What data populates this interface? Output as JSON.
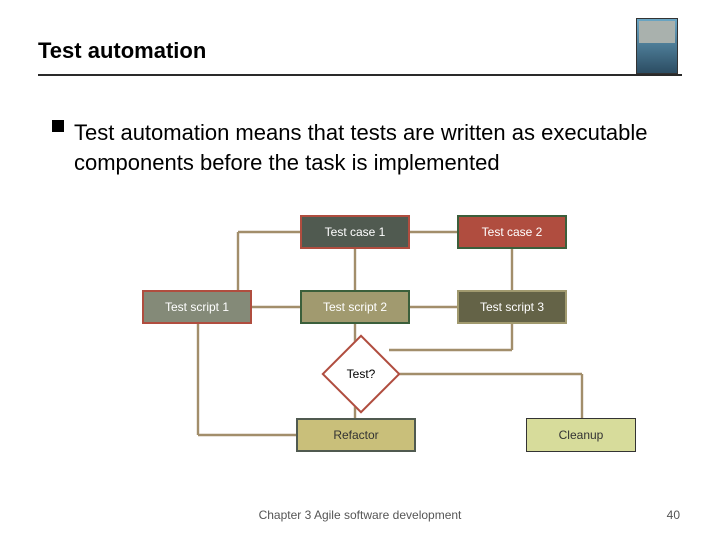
{
  "title": "Test automation",
  "bullet": "Test automation means that tests are written as executable components before the task is implemented",
  "boxes": {
    "tc1": "Test case 1",
    "tc2": "Test case 2",
    "ts1": "Test script 1",
    "ts2": "Test script 2",
    "ts3": "Test script 3",
    "decision": "Test?",
    "refactor": "Refactor",
    "cleanup": "Cleanup"
  },
  "footer": {
    "center": "Chapter 3 Agile software development",
    "page": "40"
  }
}
